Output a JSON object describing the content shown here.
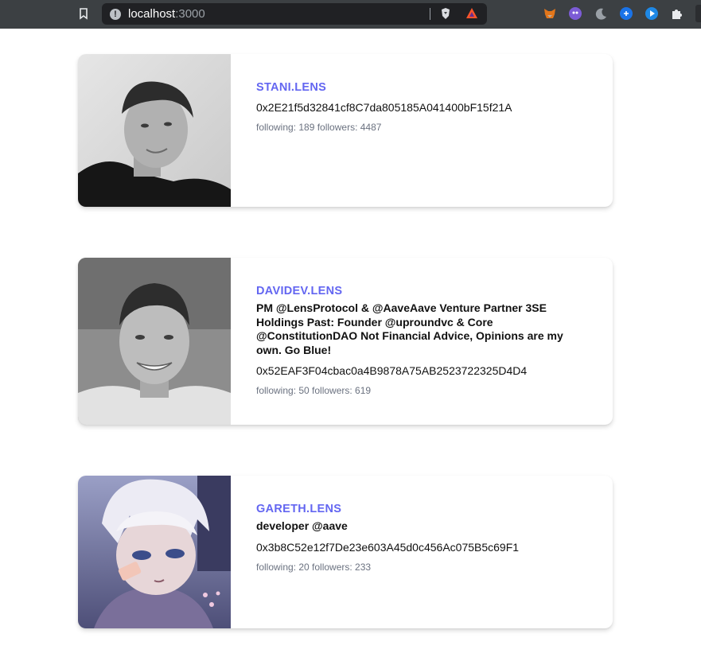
{
  "browser": {
    "url_host": "localhost",
    "url_port": ":3000",
    "extensions": [
      "metamask-fox-icon",
      "purple-ghost-icon",
      "moon-icon",
      "blue-circle-icon",
      "blue-play-icon",
      "puzzle-icon"
    ]
  },
  "profiles": [
    {
      "handle": "STANI.LENS",
      "bio": "",
      "address": "0x2E21f5d32841cf8C7da805185A041400bF15f21A",
      "stats": "following: 189 followers: 4487"
    },
    {
      "handle": "DAVIDEV.LENS",
      "bio": "PM @LensProtocol & @AaveAave Venture Partner 3SE Holdings Past: Founder @uproundvc & Core @ConstitutionDAO Not Financial Advice, Opinions are my own. Go Blue!",
      "address": "0x52EAF3F04cbac0a4B9878A75AB2523722325D4D4",
      "stats": "following: 50 followers: 619"
    },
    {
      "handle": "GARETH.LENS",
      "bio": "developer @aave",
      "address": "0x3b8C52e12f7De23e603A45d0c456Ac075B5c69F1",
      "stats": "following: 20 followers: 233"
    }
  ],
  "colors": {
    "handle": "#6366f1",
    "chrome": "#3c4043",
    "addressbar": "#202124"
  }
}
